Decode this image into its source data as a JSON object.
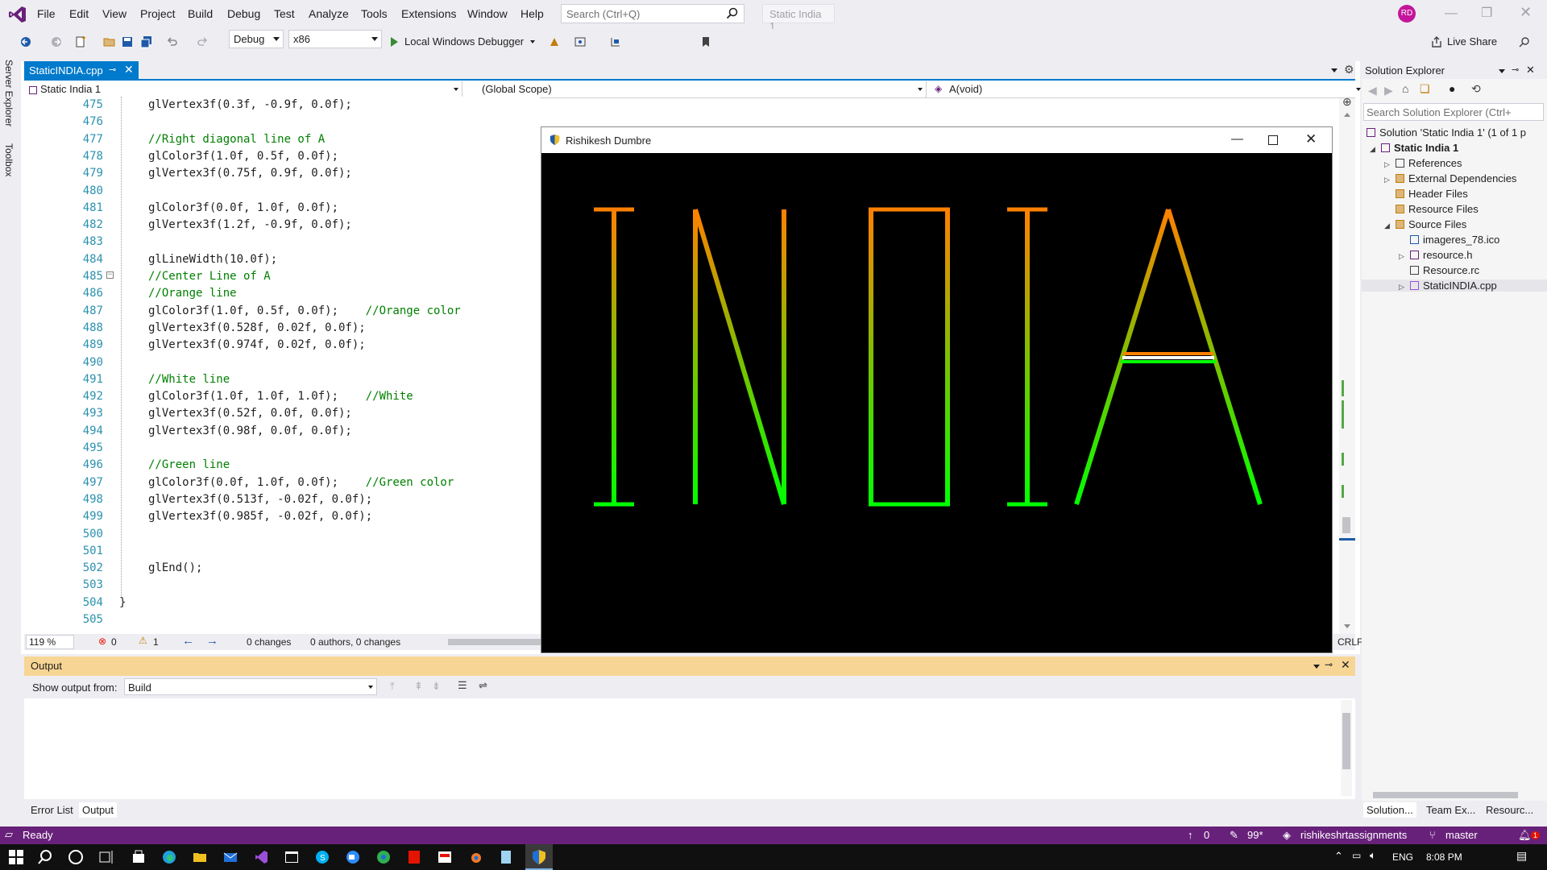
{
  "menubar": {
    "items": [
      "File",
      "Edit",
      "View",
      "Project",
      "Build",
      "Debug",
      "Test",
      "Analyze",
      "Tools",
      "Extensions",
      "Window",
      "Help"
    ],
    "search_placeholder": "Search (Ctrl+Q)",
    "solution_name": "Static India 1",
    "avatar_initials": "RD"
  },
  "toolbar": {
    "config": "Debug",
    "platform": "x86",
    "debugger": "Local Windows Debugger",
    "live_share": "Live Share"
  },
  "side_tabs": [
    "Server Explorer",
    "Toolbox"
  ],
  "editor": {
    "tab_label": "StaticINDIA.cpp",
    "nav_project": "Static India 1",
    "nav_scope": "(Global Scope)",
    "nav_member": "A(void)",
    "zoom": "119 %",
    "errors": "0",
    "warnings": "1",
    "changes": "0 changes",
    "authors": "0 authors, 0 changes",
    "line_ending": "CRLF",
    "lines": [
      {
        "n": "475",
        "code": "glVertex3f(0.3f, -0.9f, 0.0f);",
        "comment": ""
      },
      {
        "n": "476",
        "code": "",
        "comment": ""
      },
      {
        "n": "477",
        "code": "",
        "comment": "//Right diagonal line of A"
      },
      {
        "n": "478",
        "code": "glColor3f(1.0f, 0.5f, 0.0f);",
        "comment": ""
      },
      {
        "n": "479",
        "code": "glVertex3f(0.75f, 0.9f, 0.0f);",
        "comment": ""
      },
      {
        "n": "480",
        "code": "",
        "comment": ""
      },
      {
        "n": "481",
        "code": "glColor3f(0.0f, 1.0f, 0.0f);",
        "comment": ""
      },
      {
        "n": "482",
        "code": "glVertex3f(1.2f, -0.9f, 0.0f);",
        "comment": ""
      },
      {
        "n": "483",
        "code": "",
        "comment": ""
      },
      {
        "n": "484",
        "code": "glLineWidth(10.0f);",
        "comment": ""
      },
      {
        "n": "485",
        "code": "",
        "comment": "//Center Line of A"
      },
      {
        "n": "486",
        "code": "",
        "comment": "//Orange line"
      },
      {
        "n": "487",
        "code": "glColor3f(1.0f, 0.5f, 0.0f);    ",
        "comment": "//Orange color"
      },
      {
        "n": "488",
        "code": "glVertex3f(0.528f, 0.02f, 0.0f);",
        "comment": ""
      },
      {
        "n": "489",
        "code": "glVertex3f(0.974f, 0.02f, 0.0f);",
        "comment": ""
      },
      {
        "n": "490",
        "code": "",
        "comment": ""
      },
      {
        "n": "491",
        "code": "",
        "comment": "//White line"
      },
      {
        "n": "492",
        "code": "glColor3f(1.0f, 1.0f, 1.0f);    ",
        "comment": "//White"
      },
      {
        "n": "493",
        "code": "glVertex3f(0.52f, 0.0f, 0.0f);",
        "comment": ""
      },
      {
        "n": "494",
        "code": "glVertex3f(0.98f, 0.0f, 0.0f);",
        "comment": ""
      },
      {
        "n": "495",
        "code": "",
        "comment": ""
      },
      {
        "n": "496",
        "code": "",
        "comment": "//Green line"
      },
      {
        "n": "497",
        "code": "glColor3f(0.0f, 1.0f, 0.0f);    ",
        "comment": "//Green color"
      },
      {
        "n": "498",
        "code": "glVertex3f(0.513f, -0.02f, 0.0f);",
        "comment": ""
      },
      {
        "n": "499",
        "code": "glVertex3f(0.985f, -0.02f, 0.0f);",
        "comment": ""
      },
      {
        "n": "500",
        "code": "",
        "comment": ""
      },
      {
        "n": "501",
        "code": "",
        "comment": ""
      },
      {
        "n": "502",
        "code": "glEnd();",
        "comment": ""
      },
      {
        "n": "503",
        "code": "",
        "comment": ""
      },
      {
        "n": "504",
        "code": "}",
        "comment": ""
      },
      {
        "n": "505",
        "code": "",
        "comment": ""
      }
    ]
  },
  "gl_window": {
    "title": "Rishikesh Dumbre",
    "text": "INDIA",
    "colors": {
      "orange": "#ff8000",
      "green": "#00ff00",
      "white": "#ffffff",
      "background": "#000000"
    }
  },
  "output": {
    "title": "Output",
    "show_from_label": "Show output from:",
    "show_from_value": "Build"
  },
  "bottom_tabs": [
    "Error List",
    "Output"
  ],
  "solution_explorer": {
    "title": "Solution Explorer",
    "search_placeholder": "Search Solution Explorer (Ctrl+",
    "tree": [
      {
        "label": "Solution 'Static India 1' (1 of 1 p",
        "depth": 0,
        "icon": "solution-icon",
        "bold": false
      },
      {
        "label": "Static India 1",
        "depth": 1,
        "icon": "project-icon",
        "bold": true
      },
      {
        "label": "References",
        "depth": 2,
        "icon": "references-icon",
        "bold": false
      },
      {
        "label": "External Dependencies",
        "depth": 2,
        "icon": "folder-icon",
        "bold": false
      },
      {
        "label": "Header Files",
        "depth": 2,
        "icon": "folder-icon",
        "bold": false
      },
      {
        "label": "Resource Files",
        "depth": 2,
        "icon": "folder-icon",
        "bold": false
      },
      {
        "label": "Source Files",
        "depth": 2,
        "icon": "folder-icon",
        "bold": false
      },
      {
        "label": "imageres_78.ico",
        "depth": 3,
        "icon": "image-file-icon",
        "bold": false
      },
      {
        "label": "resource.h",
        "depth": 3,
        "icon": "header-file-icon",
        "bold": false
      },
      {
        "label": "Resource.rc",
        "depth": 3,
        "icon": "resource-file-icon",
        "bold": false
      },
      {
        "label": "StaticINDIA.cpp",
        "depth": 3,
        "icon": "cpp-file-icon",
        "bold": false
      }
    ],
    "tabs": [
      "Solution...",
      "Team Ex...",
      "Resourc..."
    ]
  },
  "statusbar": {
    "ready": "Ready",
    "up": "0",
    "pencil": "99*",
    "repo": "rishikeshrtassignments",
    "branch": "master",
    "notifications": "1"
  },
  "taskbar": {
    "lang": "ENG",
    "time": "8:08 PM"
  }
}
